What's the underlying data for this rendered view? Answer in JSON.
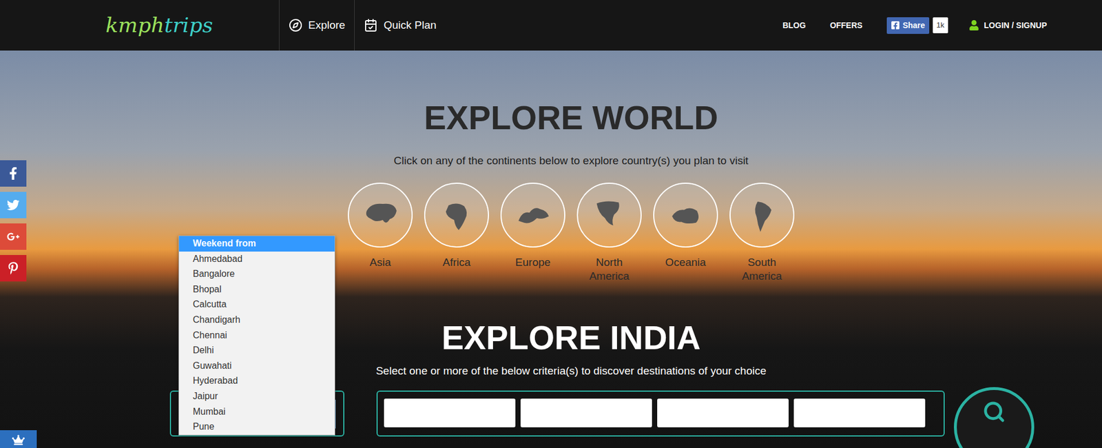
{
  "header": {
    "logo": {
      "first": "kmph",
      "second": "trips"
    },
    "nav": [
      {
        "label": "Explore"
      },
      {
        "label": "Quick Plan"
      }
    ],
    "links": [
      "BLOG",
      "OFFERS"
    ],
    "share": {
      "label": "Share",
      "count": "1k"
    },
    "login": "LOGIN / SIGNUP"
  },
  "social": [
    {
      "kind": "facebook",
      "color": "#3b5998"
    },
    {
      "kind": "twitter",
      "color": "#55acee"
    },
    {
      "kind": "googleplus",
      "color": "#dd4b39"
    },
    {
      "kind": "pinterest",
      "color": "#cb2027"
    },
    {
      "kind": "sumo",
      "color": "#2c6fbe"
    }
  ],
  "world": {
    "title": "EXPLORE WORLD",
    "subtitle": "Click on any of the continents below to explore country(s) you plan to visit",
    "continents": [
      "Asia",
      "Africa",
      "Europe",
      "North America",
      "Oceania",
      "South America"
    ]
  },
  "india": {
    "title": "EXPLORE INDIA",
    "subtitle": "Select one or more of the below criteria(s) to discover destinations of your choice",
    "dropdown": {
      "open": true,
      "options": [
        {
          "label": "Weekend from",
          "selected": true
        },
        {
          "label": "Ahmedabad",
          "selected": false
        },
        {
          "label": "Bangalore",
          "selected": false
        },
        {
          "label": "Bhopal",
          "selected": false
        },
        {
          "label": "Calcutta",
          "selected": false
        },
        {
          "label": "Chandigarh",
          "selected": false
        },
        {
          "label": "Chennai",
          "selected": false
        },
        {
          "label": "Delhi",
          "selected": false
        },
        {
          "label": "Guwahati",
          "selected": false
        },
        {
          "label": "Hyderabad",
          "selected": false
        },
        {
          "label": "Jaipur",
          "selected": false
        },
        {
          "label": "Mumbai",
          "selected": false
        },
        {
          "label": "Pune",
          "selected": false
        }
      ]
    },
    "fields": [
      {
        "value": ""
      },
      {
        "value": ""
      },
      {
        "value": ""
      },
      {
        "value": ""
      }
    ]
  }
}
